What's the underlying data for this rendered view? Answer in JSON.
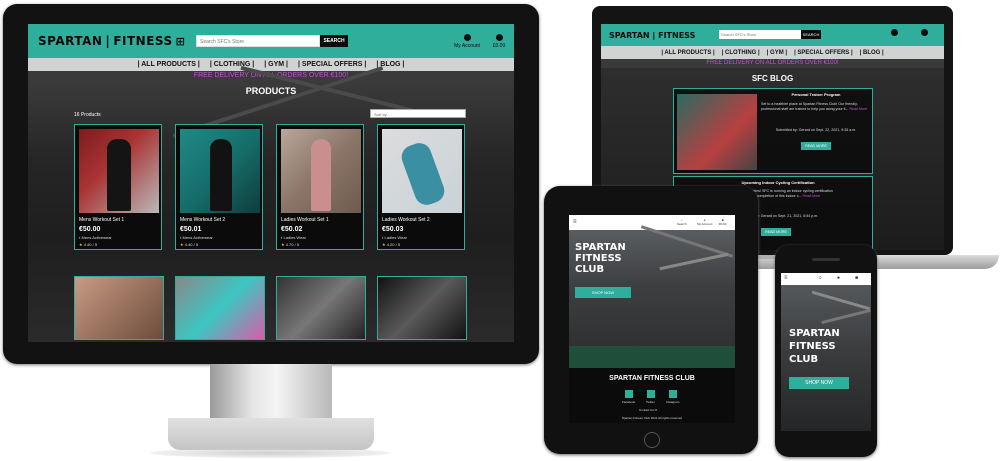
{
  "brand": {
    "accent": "#2fae9c",
    "promo_color": "#c84fd8"
  },
  "desktop": {
    "logo_left": "SPARTAN",
    "logo_right": "FITNESS",
    "search_placeholder": "Search SFC's Store",
    "search_button": "SEARCH",
    "account_label": "My Account",
    "bag_label": "£0.00",
    "nav": [
      "| ALL PRODUCTS |",
      "| CLOTHING |",
      "| GYM |",
      "| SPECIAL OFFERS |",
      "| BLOG |"
    ],
    "promo": "FREE DELIVERY ON ALL ORDERS OVER €100!",
    "page_title": "PRODUCTS",
    "product_count": "16 Products",
    "sort_placeholder": "Sort by...",
    "products": [
      {
        "name": "Mens Workout Set 1",
        "price": "€50.00",
        "category": "Mens Activewear",
        "rating": "4.40 / 5",
        "img_colors": [
          "#7a1d1d",
          "#b9b9b9"
        ]
      },
      {
        "name": "Mens Workout Set 2",
        "price": "€50.01",
        "category": "Mens Activewear",
        "rating": "4.40 / 5",
        "img_colors": [
          "#1f8a86",
          "#0f3d3c"
        ]
      },
      {
        "name": "Ladies Workout Set 1",
        "price": "€50.02",
        "category": "Ladies Wear",
        "rating": "4.70 / 5",
        "img_colors": [
          "#b9a79a",
          "#6e5a4f"
        ]
      },
      {
        "name": "Ladies Workout Set 2",
        "price": "€50.03",
        "category": "Ladies Wear",
        "rating": "4.20 / 5",
        "img_colors": [
          "#dcdcdc",
          "#c9d2d8"
        ]
      }
    ]
  },
  "laptop": {
    "logo_left": "SPARTAN",
    "logo_right": "FITNESS",
    "search_placeholder": "Search SFC's Store",
    "search_button": "SEARCH",
    "nav": [
      "| ALL PRODUCTS |",
      "| CLOTHING |",
      "| GYM |",
      "| SPECIAL OFFERS |",
      "| BLOG |"
    ],
    "promo": "FREE DELIVERY ON ALL ORDERS OVER €100!",
    "page_title": "SFC BLOG",
    "posts": [
      {
        "title": "Personal Trainer Program",
        "body": "Set to a healthier place at Spartan Fitness Club! Our friendly, professional staff are trained to help you along your fi...",
        "more": "Read More",
        "submitted": "Submitted by: Gerard on Sept. 22, 2021, 9:35 a.m.",
        "button": "READ MORE"
      },
      {
        "title": "Upcoming Indoor Cycling Certification",
        "body": "To all interested parties! SFC is running an indoor cycling certification program. Successful completion of this indoor c...",
        "more": "Read More",
        "submitted": "Submitted by: Gerard on Sept. 21, 2021, 6:54 p.m.",
        "button": "READ MORE"
      }
    ]
  },
  "tablet": {
    "header_labels": [
      "Search",
      "My Account",
      "€0.00"
    ],
    "brand_lines": [
      "SPARTAN",
      "FITNESS",
      "CLUB"
    ],
    "shop_button": "SHOP NOW",
    "footer_title": "SPARTAN FITNESS CLUB",
    "social": [
      "Facebook",
      "Twitter",
      "Instagram"
    ],
    "contact": "Contact Us",
    "copyright": "Spartan Fitness Club 2021 All rights reserved"
  },
  "phone": {
    "brand_lines": [
      "SPARTAN",
      "FITNESS",
      "CLUB"
    ],
    "shop_button": "SHOP NOW"
  }
}
